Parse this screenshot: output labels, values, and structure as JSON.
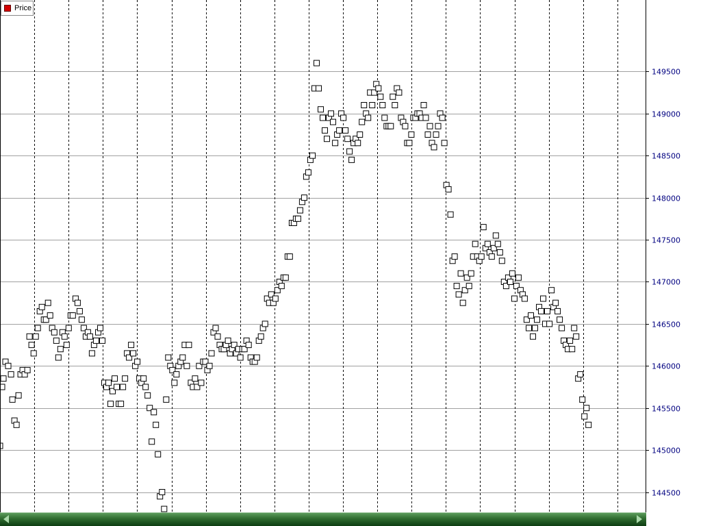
{
  "chart_data": {
    "type": "scatter",
    "legend": {
      "entries": [
        "Price"
      ],
      "placement": "top-left"
    },
    "y_axis": {
      "side": "right",
      "ylim": [
        144260,
        150350
      ],
      "ticks": [
        144500,
        145000,
        145500,
        146000,
        146500,
        147000,
        147500,
        148000,
        148500,
        149000,
        149500
      ]
    },
    "grid": {
      "horizontal": true,
      "vertical_dashed": true,
      "x_divisions": 18
    },
    "x_range": [
      0,
      940
    ],
    "colors": {
      "marker_edge": "#000000",
      "marker_fill": "#ffffff",
      "legend_swatch": "#d40000",
      "scrollbar": "#2e6a2e"
    },
    "series": [
      {
        "name": "Price",
        "points": [
          [
            0,
            145050
          ],
          [
            3,
            145750
          ],
          [
            5,
            145850
          ],
          [
            8,
            146050
          ],
          [
            12,
            146000
          ],
          [
            16,
            145900
          ],
          [
            18,
            145600
          ],
          [
            21,
            145350
          ],
          [
            24,
            145300
          ],
          [
            27,
            145650
          ],
          [
            30,
            145900
          ],
          [
            33,
            145950
          ],
          [
            36,
            145900
          ],
          [
            40,
            145950
          ],
          [
            43,
            146350
          ],
          [
            46,
            146250
          ],
          [
            49,
            146150
          ],
          [
            52,
            146350
          ],
          [
            55,
            146450
          ],
          [
            58,
            146650
          ],
          [
            61,
            146700
          ],
          [
            64,
            146550
          ],
          [
            67,
            146550
          ],
          [
            70,
            146750
          ],
          [
            73,
            146600
          ],
          [
            76,
            146450
          ],
          [
            79,
            146400
          ],
          [
            82,
            146300
          ],
          [
            85,
            146100
          ],
          [
            88,
            146200
          ],
          [
            91,
            146400
          ],
          [
            94,
            146350
          ],
          [
            97,
            146250
          ],
          [
            100,
            146450
          ],
          [
            103,
            146600
          ],
          [
            106,
            146600
          ],
          [
            110,
            146800
          ],
          [
            113,
            146750
          ],
          [
            116,
            146650
          ],
          [
            119,
            146550
          ],
          [
            122,
            146450
          ],
          [
            125,
            146350
          ],
          [
            128,
            146400
          ],
          [
            131,
            146350
          ],
          [
            134,
            146150
          ],
          [
            137,
            146250
          ],
          [
            140,
            146300
          ],
          [
            143,
            146400
          ],
          [
            146,
            146450
          ],
          [
            149,
            146300
          ],
          [
            152,
            145800
          ],
          [
            155,
            145750
          ],
          [
            158,
            145800
          ],
          [
            161,
            145550
          ],
          [
            164,
            145700
          ],
          [
            167,
            145850
          ],
          [
            170,
            145750
          ],
          [
            173,
            145550
          ],
          [
            176,
            145550
          ],
          [
            179,
            145750
          ],
          [
            182,
            145850
          ],
          [
            185,
            146150
          ],
          [
            188,
            146100
          ],
          [
            191,
            146250
          ],
          [
            194,
            146150
          ],
          [
            197,
            146000
          ],
          [
            200,
            146050
          ],
          [
            203,
            145850
          ],
          [
            206,
            145800
          ],
          [
            209,
            145850
          ],
          [
            212,
            145750
          ],
          [
            215,
            145650
          ],
          [
            218,
            145500
          ],
          [
            221,
            145100
          ],
          [
            224,
            145450
          ],
          [
            227,
            145300
          ],
          [
            230,
            144950
          ],
          [
            233,
            144450
          ],
          [
            236,
            144500
          ],
          [
            239,
            144300
          ],
          [
            242,
            145600
          ],
          [
            245,
            146100
          ],
          [
            248,
            146000
          ],
          [
            251,
            145950
          ],
          [
            254,
            145800
          ],
          [
            257,
            145900
          ],
          [
            260,
            146000
          ],
          [
            263,
            146050
          ],
          [
            266,
            146100
          ],
          [
            269,
            146250
          ],
          [
            272,
            146000
          ],
          [
            275,
            146250
          ],
          [
            278,
            145800
          ],
          [
            281,
            145750
          ],
          [
            284,
            145850
          ],
          [
            287,
            145750
          ],
          [
            290,
            146000
          ],
          [
            293,
            145800
          ],
          [
            296,
            146050
          ],
          [
            299,
            146050
          ],
          [
            302,
            145950
          ],
          [
            305,
            146000
          ],
          [
            308,
            146150
          ],
          [
            311,
            146400
          ],
          [
            314,
            146450
          ],
          [
            317,
            146350
          ],
          [
            320,
            146250
          ],
          [
            323,
            146200
          ],
          [
            326,
            146200
          ],
          [
            329,
            146250
          ],
          [
            332,
            146300
          ],
          [
            335,
            146150
          ],
          [
            338,
            146200
          ],
          [
            341,
            146250
          ],
          [
            344,
            146150
          ],
          [
            347,
            146200
          ],
          [
            350,
            146100
          ],
          [
            353,
            146200
          ],
          [
            356,
            146200
          ],
          [
            359,
            146300
          ],
          [
            362,
            146250
          ],
          [
            365,
            146100
          ],
          [
            368,
            146050
          ],
          [
            371,
            146050
          ],
          [
            374,
            146100
          ],
          [
            377,
            146300
          ],
          [
            380,
            146350
          ],
          [
            383,
            146450
          ],
          [
            386,
            146500
          ],
          [
            389,
            146800
          ],
          [
            392,
            146750
          ],
          [
            395,
            146850
          ],
          [
            398,
            146750
          ],
          [
            401,
            146800
          ],
          [
            404,
            146900
          ],
          [
            407,
            147000
          ],
          [
            410,
            146950
          ],
          [
            413,
            147050
          ],
          [
            416,
            147050
          ],
          [
            419,
            147300
          ],
          [
            422,
            147300
          ],
          [
            425,
            147700
          ],
          [
            428,
            147700
          ],
          [
            431,
            147750
          ],
          [
            434,
            147750
          ],
          [
            437,
            147850
          ],
          [
            440,
            147950
          ],
          [
            443,
            148000
          ],
          [
            446,
            148250
          ],
          [
            449,
            148300
          ],
          [
            452,
            148450
          ],
          [
            455,
            148500
          ],
          [
            458,
            149300
          ],
          [
            461,
            149600
          ],
          [
            464,
            149300
          ],
          [
            467,
            149050
          ],
          [
            470,
            148950
          ],
          [
            473,
            148800
          ],
          [
            476,
            148700
          ],
          [
            479,
            148950
          ],
          [
            482,
            149000
          ],
          [
            485,
            148900
          ],
          [
            488,
            148650
          ],
          [
            491,
            148750
          ],
          [
            494,
            148800
          ],
          [
            497,
            149000
          ],
          [
            500,
            148950
          ],
          [
            503,
            148800
          ],
          [
            506,
            148700
          ],
          [
            509,
            148550
          ],
          [
            512,
            148450
          ],
          [
            515,
            148650
          ],
          [
            518,
            148700
          ],
          [
            521,
            148650
          ],
          [
            524,
            148750
          ],
          [
            527,
            148900
          ],
          [
            530,
            149100
          ],
          [
            533,
            149000
          ],
          [
            536,
            148950
          ],
          [
            539,
            149250
          ],
          [
            542,
            149100
          ],
          [
            545,
            149250
          ],
          [
            548,
            149350
          ],
          [
            551,
            149300
          ],
          [
            554,
            149200
          ],
          [
            557,
            149100
          ],
          [
            560,
            148950
          ],
          [
            563,
            148850
          ],
          [
            566,
            148850
          ],
          [
            569,
            148850
          ],
          [
            572,
            149200
          ],
          [
            575,
            149100
          ],
          [
            578,
            149300
          ],
          [
            581,
            149250
          ],
          [
            584,
            148950
          ],
          [
            587,
            148900
          ],
          [
            590,
            148850
          ],
          [
            593,
            148650
          ],
          [
            596,
            148650
          ],
          [
            599,
            148750
          ],
          [
            602,
            148950
          ],
          [
            605,
            148950
          ],
          [
            608,
            149000
          ],
          [
            611,
            149000
          ],
          [
            614,
            148950
          ],
          [
            617,
            149100
          ],
          [
            620,
            148950
          ],
          [
            623,
            148750
          ],
          [
            626,
            148850
          ],
          [
            629,
            148650
          ],
          [
            632,
            148600
          ],
          [
            635,
            148750
          ],
          [
            638,
            148850
          ],
          [
            641,
            149000
          ],
          [
            644,
            148950
          ],
          [
            647,
            148650
          ],
          [
            650,
            148150
          ],
          [
            653,
            148100
          ],
          [
            656,
            147800
          ],
          [
            659,
            147250
          ],
          [
            662,
            147300
          ],
          [
            665,
            146950
          ],
          [
            668,
            146850
          ],
          [
            671,
            147100
          ],
          [
            674,
            146750
          ],
          [
            677,
            146900
          ],
          [
            680,
            147050
          ],
          [
            683,
            146950
          ],
          [
            686,
            147100
          ],
          [
            689,
            147300
          ],
          [
            692,
            147450
          ],
          [
            695,
            147300
          ],
          [
            698,
            147250
          ],
          [
            701,
            147300
          ],
          [
            704,
            147650
          ],
          [
            707,
            147400
          ],
          [
            710,
            147450
          ],
          [
            713,
            147350
          ],
          [
            716,
            147300
          ],
          [
            719,
            147400
          ],
          [
            722,
            147550
          ],
          [
            725,
            147450
          ],
          [
            728,
            147350
          ],
          [
            731,
            147250
          ],
          [
            734,
            147000
          ],
          [
            737,
            146950
          ],
          [
            740,
            147050
          ],
          [
            743,
            147000
          ],
          [
            746,
            147100
          ],
          [
            749,
            146800
          ],
          [
            752,
            146950
          ],
          [
            755,
            147050
          ],
          [
            758,
            146900
          ],
          [
            761,
            146850
          ],
          [
            764,
            146800
          ],
          [
            767,
            146550
          ],
          [
            770,
            146450
          ],
          [
            773,
            146600
          ],
          [
            776,
            146350
          ],
          [
            779,
            146450
          ],
          [
            782,
            146550
          ],
          [
            785,
            146700
          ],
          [
            788,
            146650
          ],
          [
            791,
            146800
          ],
          [
            794,
            146500
          ],
          [
            797,
            146650
          ],
          [
            800,
            146500
          ],
          [
            803,
            146900
          ],
          [
            806,
            146700
          ],
          [
            809,
            146750
          ],
          [
            812,
            146650
          ],
          [
            815,
            146550
          ],
          [
            818,
            146450
          ],
          [
            821,
            146300
          ],
          [
            824,
            146250
          ],
          [
            827,
            146200
          ],
          [
            830,
            146300
          ],
          [
            833,
            146200
          ],
          [
            836,
            146450
          ],
          [
            839,
            146350
          ],
          [
            842,
            145850
          ],
          [
            845,
            145900
          ],
          [
            848,
            145600
          ],
          [
            851,
            145400
          ],
          [
            854,
            145500
          ],
          [
            857,
            145300
          ]
        ]
      }
    ]
  }
}
